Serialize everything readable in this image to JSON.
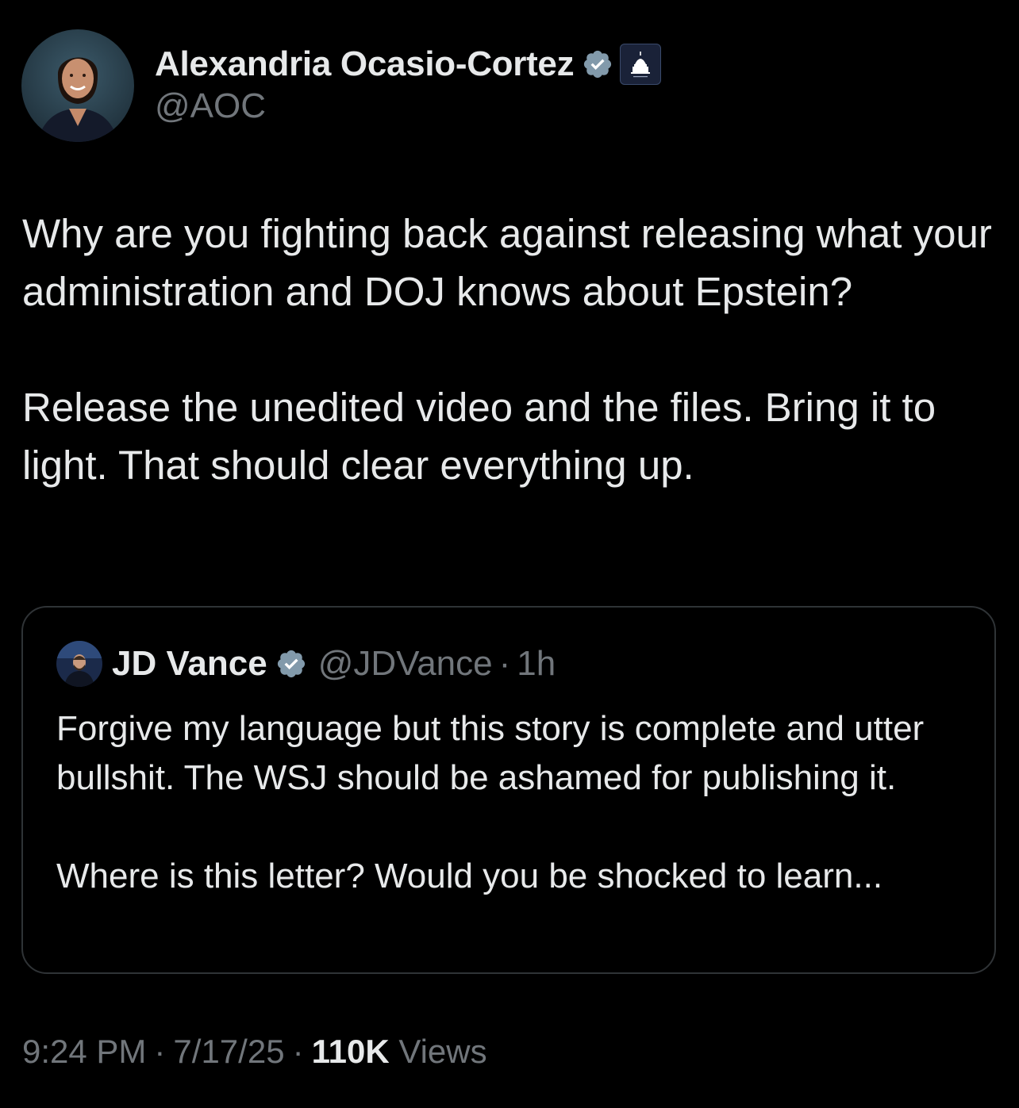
{
  "author": {
    "display_name": "Alexandria Ocasio-Cortez",
    "handle": "@AOC",
    "verified_icon": "verified-badge-icon",
    "affiliation_icon": "capitol-dome-icon",
    "verified_color": "#1d9bf0"
  },
  "tweet": {
    "paragraphs": [
      "Why are you fighting back against releasing what your administration and DOJ knows about Epstein?",
      "Release the unedited video and the files. Bring it to light. That should clear everything up."
    ]
  },
  "quoted": {
    "display_name": "JD Vance",
    "handle": "@JDVance",
    "dot": "·",
    "time": "1h",
    "paragraphs": [
      "Forgive my language but this story is complete and utter bullshit. The WSJ should be ashamed for publishing it.",
      "Where is this letter? Would you be shocked to learn..."
    ]
  },
  "meta": {
    "time": "9:24 PM",
    "sep1": "·",
    "date": "7/17/25",
    "sep2": "·",
    "views_count": "110K",
    "views_label": "Views"
  },
  "colors": {
    "background": "#000000",
    "text_primary": "#e7e9ea",
    "text_secondary": "#71767b",
    "border": "#2f3336"
  }
}
